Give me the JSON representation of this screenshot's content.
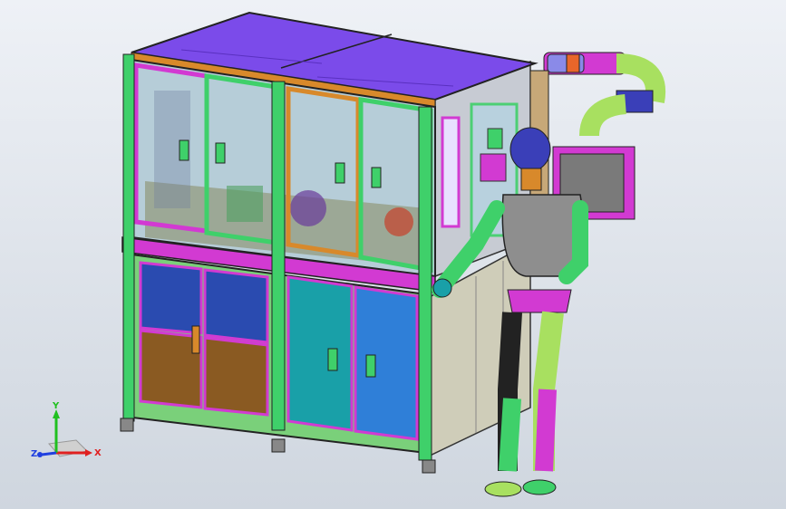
{
  "colors": {
    "background_top": "#eef1f6",
    "background_bottom": "#cfd6df",
    "roof": "#7b4bea",
    "frame_green": "#3fd06a",
    "frame_magenta": "#d23ad2",
    "frame_orange": "#d8892b",
    "door_dark_blue": "#2a4bb0",
    "door_brown": "#8a5a22",
    "door_teal": "#19a0a8",
    "door_blue": "#2f7fd8",
    "side_panel": "#cfcdb9",
    "robot_grey": "#8e8e8e",
    "robot_navy": "#3a3fb8",
    "axis_x": "#e02020",
    "axis_y": "#20c020",
    "axis_z": "#2040e0"
  },
  "triad": {
    "x_label": "X",
    "y_label": "Y",
    "z_label": "Z"
  }
}
